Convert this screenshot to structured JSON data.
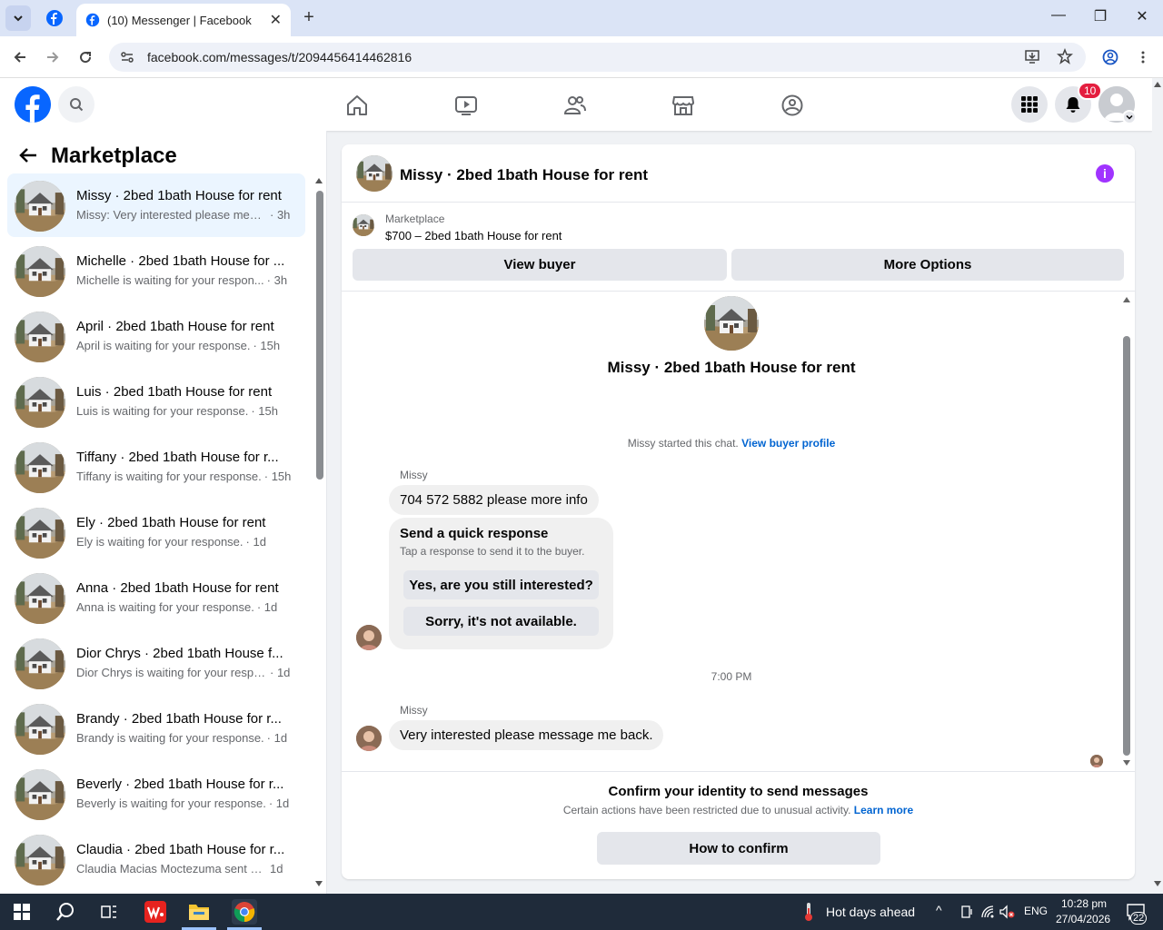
{
  "browser": {
    "tab_title": "(10) Messenger | Facebook",
    "url": "facebook.com/messages/t/2094456414462816"
  },
  "header": {
    "notification_count": "10"
  },
  "sidebar": {
    "title": "Marketplace",
    "conversations": [
      {
        "name": "Missy · 2bed 1bath House for rent",
        "preview": "Missy: Very interested please mess...",
        "time": "· 3h"
      },
      {
        "name": "Michelle · 2bed 1bath House for ...",
        "preview": "Michelle is waiting for your respon...",
        "time": "· 3h"
      },
      {
        "name": "April · 2bed 1bath House for rent",
        "preview": "April is waiting for your response.",
        "time": "· 15h"
      },
      {
        "name": "Luis · 2bed 1bath House for rent",
        "preview": "Luis is waiting for your response.",
        "time": "· 15h"
      },
      {
        "name": "Tiffany · 2bed 1bath House for r...",
        "preview": "Tiffany is waiting for your response.",
        "time": "· 15h"
      },
      {
        "name": "Ely · 2bed 1bath House for rent",
        "preview": "Ely is waiting for your response.",
        "time": "· 1d"
      },
      {
        "name": "Anna · 2bed 1bath House for rent",
        "preview": "Anna is waiting for your response.",
        "time": "· 1d"
      },
      {
        "name": "Dior Chrys · 2bed 1bath House f...",
        "preview": "Dior Chrys is waiting for your respo...",
        "time": "· 1d"
      },
      {
        "name": "Brandy · 2bed 1bath House for r...",
        "preview": "Brandy is waiting for your response.",
        "time": "· 1d"
      },
      {
        "name": "Beverly · 2bed 1bath House for r...",
        "preview": "Beverly is waiting for your response.",
        "time": "· 1d"
      },
      {
        "name": "Claudia · 2bed 1bath House for r...",
        "preview": "Claudia Macias Moctezuma sent yo...",
        "time": "1d"
      }
    ]
  },
  "chat": {
    "title": "Missy · 2bed 1bath House for rent",
    "marketplace_label": "Marketplace",
    "listing": "$700 – 2bed 1bath House for rent",
    "view_buyer": "View buyer",
    "more_options": "More Options",
    "started_text": "Missy started this chat.",
    "view_buyer_profile": "View buyer profile",
    "sender1": "Missy",
    "message1": "704 572 5882 please more info",
    "quick_title": "Send a quick response",
    "quick_sub": "Tap a response to send it to the buyer.",
    "quick_opt1": "Yes, are you still interested?",
    "quick_opt2": "Sorry, it's not available.",
    "timestamp": "7:00 PM",
    "sender2": "Missy",
    "message2": "Very interested please message me back.",
    "confirm_title": "Confirm your identity to send messages",
    "confirm_sub": "Certain actions have been restricted due to unusual activity.",
    "learn_more": "Learn more",
    "how_to_confirm": "How to confirm"
  },
  "taskbar": {
    "weather": "Hot days ahead",
    "lang": "ENG",
    "time": "10:28 pm",
    "date": "27/04/2026",
    "notif_count": "22"
  },
  "colors": {
    "fb_blue": "#0866ff",
    "link_blue": "#0064d1",
    "badge_red": "#e41e3f",
    "info_purple": "#a033ff"
  }
}
